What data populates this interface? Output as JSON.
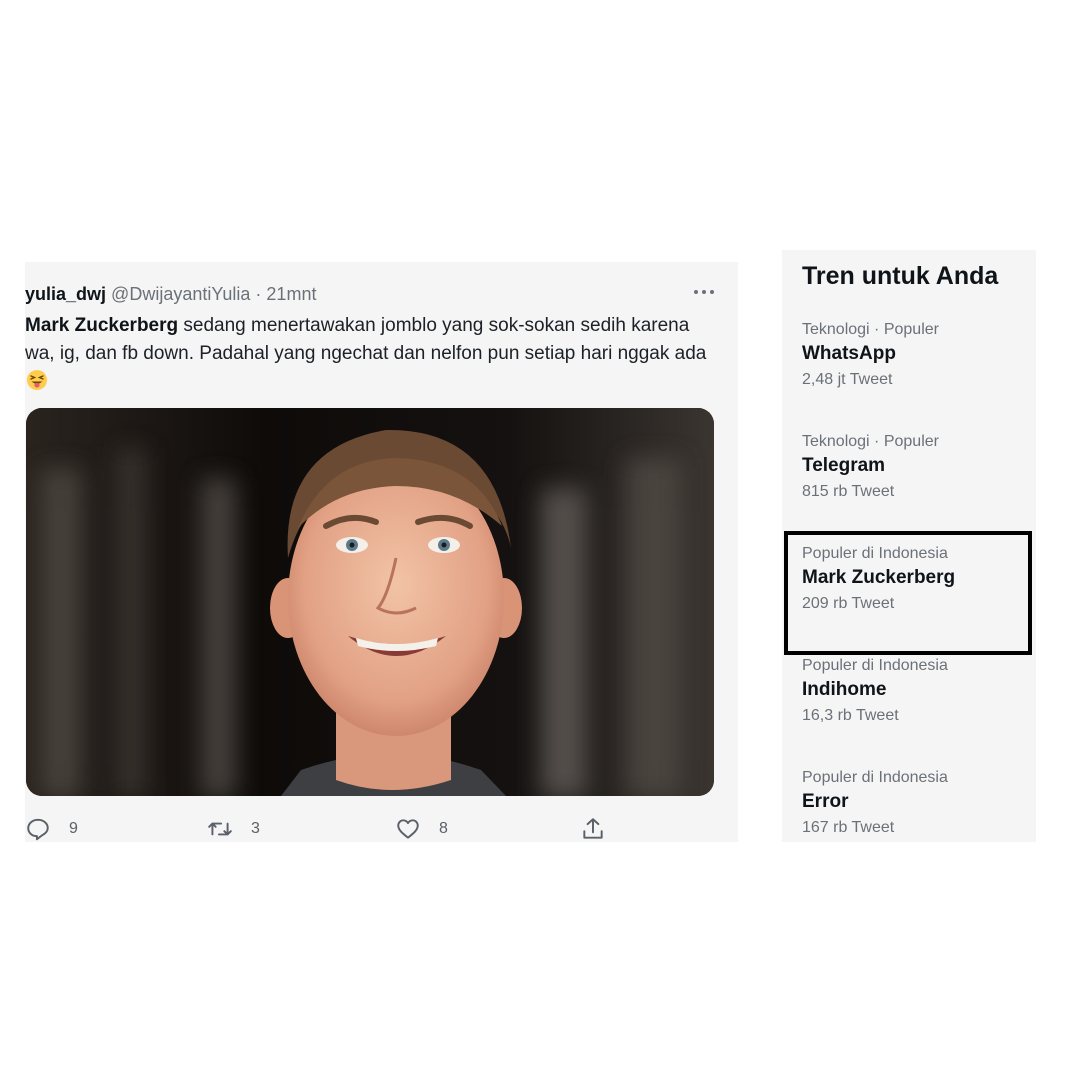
{
  "tweet": {
    "display_name": "yulia_dwj",
    "handle": "@DwijayantiYulia",
    "separator": "·",
    "time": "21mnt",
    "text_bold": "Mark Zuckerberg",
    "text_rest": " sedang menertawakan jomblo yang sok-sokan sedih karena wa, ig, dan fb down. Padahal yang ngechat dan nelfon pun setiap hari nggak ada",
    "emoji": "squinting-face-with-tongue",
    "image_alt": "photo of a smiling man",
    "actions": {
      "reply_count": "9",
      "retweet_count": "3",
      "like_count": "8"
    }
  },
  "trends": {
    "title": "Tren untuk Anda",
    "items": [
      {
        "meta": "Teknologi · Populer",
        "name": "WhatsApp",
        "count": "2,48 jt Tweet"
      },
      {
        "meta": "Teknologi · Populer",
        "name": "Telegram",
        "count": "815 rb Tweet"
      },
      {
        "meta": "Populer di Indonesia",
        "name": "Mark Zuckerberg",
        "count": "209 rb Tweet"
      },
      {
        "meta": "Populer di Indonesia",
        "name": "Indihome",
        "count": "16,3 rb Tweet"
      },
      {
        "meta": "Populer di Indonesia",
        "name": "Error",
        "count": "167 rb Tweet"
      }
    ]
  },
  "colors": {
    "panel_bg": "#f5f5f5",
    "text_primary": "#0f1419",
    "text_secondary": "#6b7178",
    "highlight_border": "#000000"
  }
}
